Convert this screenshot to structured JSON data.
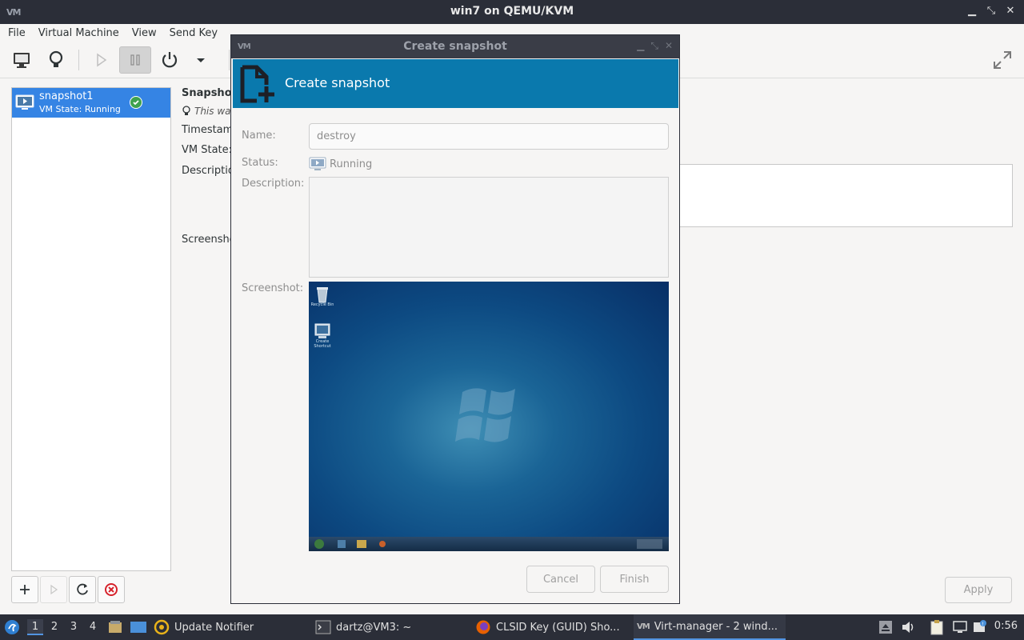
{
  "window": {
    "title": "win7 on QEMU/KVM",
    "logo_text": "VM"
  },
  "menubar": {
    "items": [
      "File",
      "Virtual Machine",
      "View",
      "Send Key"
    ]
  },
  "toolbar": {
    "buttons": [
      "console-icon",
      "details-bulb-icon",
      "run-icon",
      "pause-icon",
      "power-icon",
      "power-menu-chevron-icon"
    ],
    "pause_pressed": true
  },
  "snapshots": {
    "items": [
      {
        "name": "snapshot1",
        "state": "VM State: Running",
        "selected": true
      }
    ]
  },
  "detail": {
    "header": "Snapshot",
    "hint": "This wa",
    "timestamp_label": "Timestam",
    "vmstate_label": "VM State:",
    "description_label": "Descriptio",
    "screenshot_label": "Screensho",
    "apply_label": "Apply"
  },
  "dialog": {
    "title": "Create snapshot",
    "banner_title": "Create snapshot",
    "name_label": "Name:",
    "name_value": "destroy",
    "status_label": "Status:",
    "status_value": "Running",
    "description_label": "Description:",
    "screenshot_label": "Screenshot:",
    "cancel_label": "Cancel",
    "finish_label": "Finish",
    "desktop_icons": [
      "Recycle Bin",
      "Create Shortcut"
    ]
  },
  "panel": {
    "workspaces": [
      "1",
      "2",
      "3",
      "4"
    ],
    "active_workspace": "1",
    "tasks": [
      {
        "label": "Update Notifier",
        "icon": "update-notifier-icon"
      },
      {
        "label": "dartz@VM3: ~",
        "icon": "terminal-icon"
      },
      {
        "label": "CLSID Key (GUID) Sho...",
        "icon": "firefox-icon"
      },
      {
        "label": "Virt-manager - 2 wind...",
        "icon": "virt-manager-icon",
        "active": true
      }
    ],
    "clock": "0:56"
  },
  "colors": {
    "accent": "#3584e4",
    "banner": "#0a79ad",
    "titlebar": "#2b2e38"
  }
}
